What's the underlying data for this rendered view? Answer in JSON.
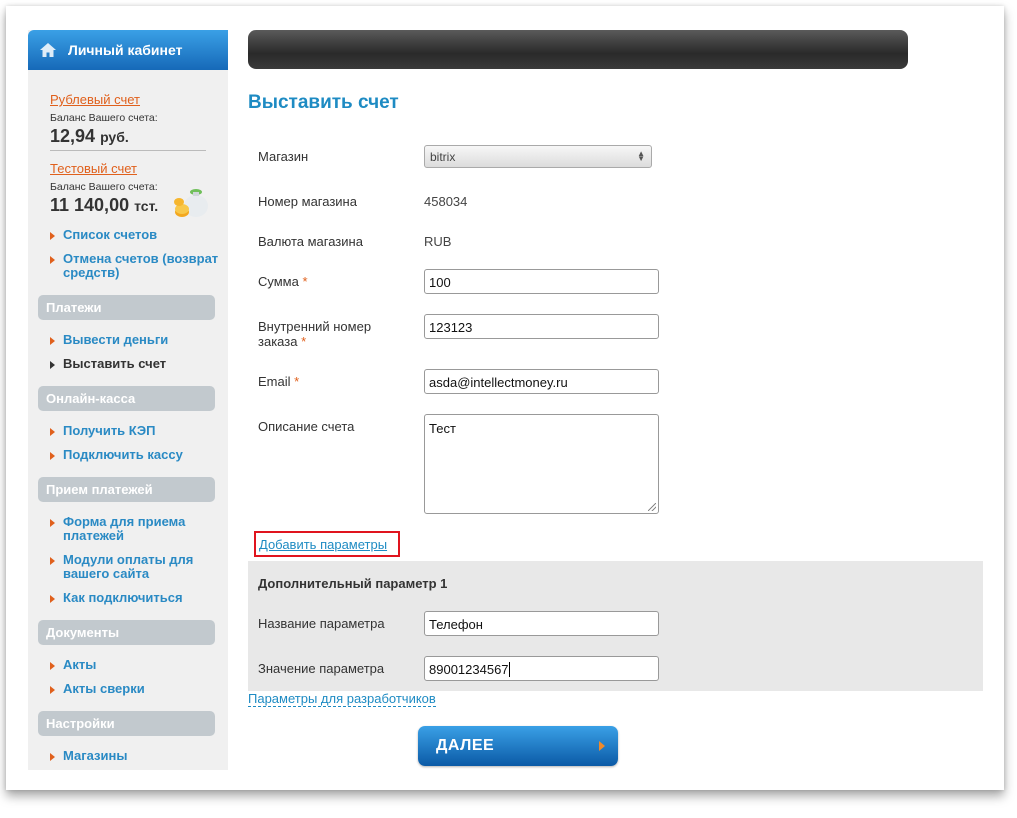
{
  "sidebar": {
    "header": "Личный кабинет",
    "ruble_account": {
      "link": "Рублевый счет",
      "balance_label": "Баланс Вашего счета:",
      "balance": "12,94",
      "currency": "руб."
    },
    "test_account": {
      "link": "Тестовый счет",
      "balance_label": "Баланс Вашего счета:",
      "balance": "11 140,00",
      "currency": "тст."
    },
    "account_items": [
      "Список счетов",
      "Отмена счетов (возврат средств)"
    ],
    "sections": [
      {
        "title": "Платежи",
        "items": [
          "Вывести деньги",
          "Выставить счет"
        ]
      },
      {
        "title": "Онлайн-касса",
        "items": [
          "Получить КЭП",
          "Подключить кассу"
        ]
      },
      {
        "title": "Прием платежей",
        "items": [
          "Форма для приема платежей",
          "Модули оплаты для вашего сайта",
          "Как подключиться"
        ]
      },
      {
        "title": "Документы",
        "items": [
          "Акты",
          "Акты сверки"
        ]
      },
      {
        "title": "Настройки",
        "items": [
          "Магазины"
        ]
      }
    ],
    "active_item": "Выставить счет"
  },
  "main": {
    "title": "Выставить счет",
    "form": {
      "shop_label": "Магазин",
      "shop_value": "bitrix",
      "shop_number_label": "Номер магазина",
      "shop_number": "458034",
      "currency_label": "Валюта магазина",
      "currency": "RUB",
      "sum_label": "Сумма",
      "sum": "100",
      "order_label": "Внутренний номер заказа",
      "order": "123123",
      "email_label": "Email",
      "email": "asda@intellectmoney.ru",
      "desc_label": "Описание счета",
      "desc": "Тест",
      "required_mark": "*"
    },
    "add_params": "Добавить параметры",
    "extra": {
      "title": "Дополнительный параметр 1",
      "name_label": "Название параметра",
      "name": "Телефон",
      "value_label": "Значение параметра",
      "value": "89001234567"
    },
    "dev_link": "Параметры для разработчиков",
    "next_button": "ДАЛЕЕ"
  },
  "colors": {
    "accent_blue": "#1e8bc3",
    "link_orange": "#e0601c",
    "highlight_red": "#e0141e"
  }
}
